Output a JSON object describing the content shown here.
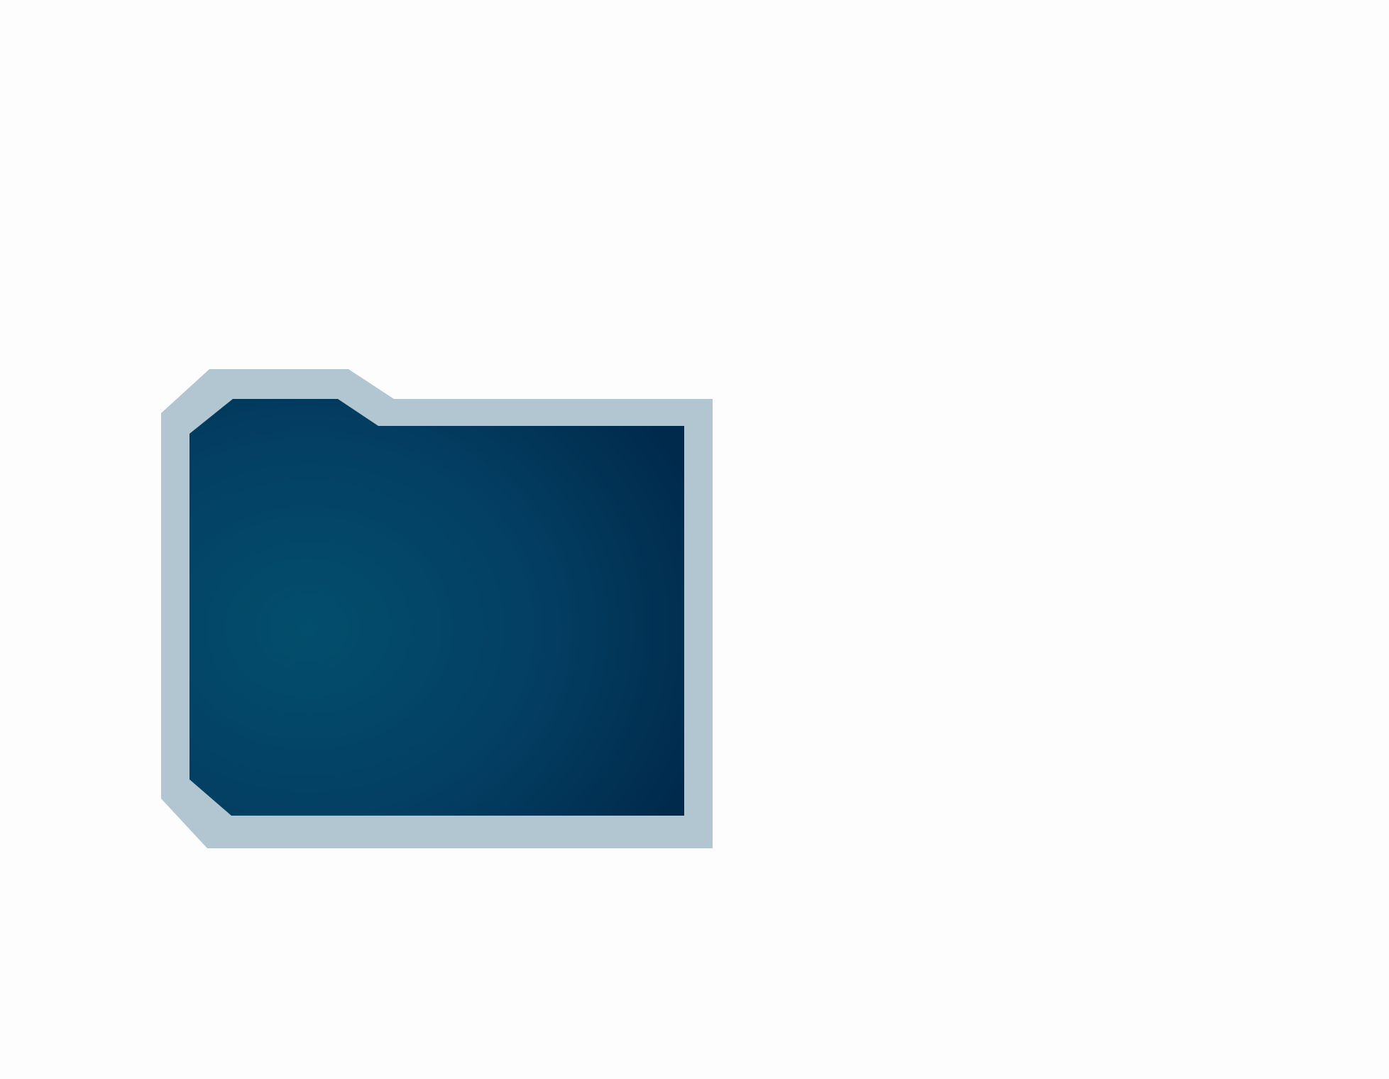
{
  "icon": {
    "name": "folder-icon",
    "colors": {
      "background": "#fdfdfd",
      "frame": "#b2c6d2",
      "body_light": "#034e6c",
      "body_mid": "#033f63",
      "body_dark": "#002a4c"
    }
  }
}
